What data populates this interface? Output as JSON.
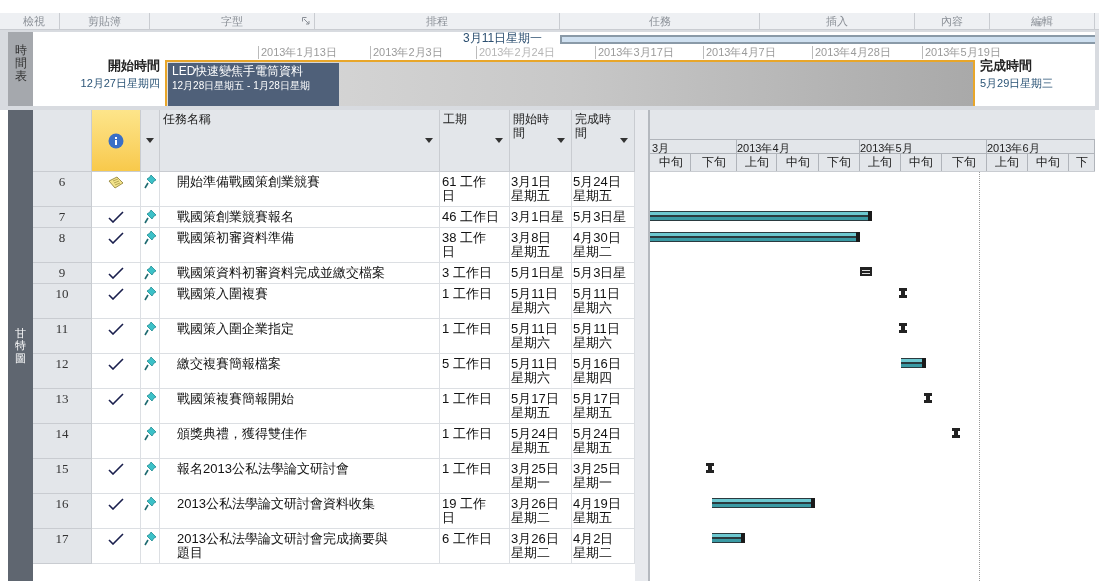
{
  "ribbon_groups": [
    {
      "label": "檢視"
    },
    {
      "label": "剪貼簿"
    },
    {
      "label": "字型",
      "launcher": true
    },
    {
      "label": "排程"
    },
    {
      "label": "任務"
    },
    {
      "label": "插入"
    },
    {
      "label": "內容"
    },
    {
      "label": "編輯"
    }
  ],
  "timeline": {
    "side_label": "時間表",
    "start_label": "開始時間",
    "start_date": "12月27日星期四",
    "today_label": "3月11日星期一",
    "ticks": [
      "2013年1月13日",
      "2013年2月3日",
      "2013年2月24日",
      "2013年3月17日",
      "2013年4月7日",
      "2013年4月28日",
      "2013年5月19日"
    ],
    "callout": {
      "title": "LED快速變焦手電筒資料",
      "dates": "12月28日星期五 - 1月28日星期"
    },
    "finish_label": "完成時間",
    "finish_date": "5月29日星期三"
  },
  "view_label": "甘特圖",
  "columns": [
    {
      "kind": "indicator",
      "selected": true
    },
    {
      "kind": "mode",
      "selected": false
    },
    {
      "kind": "text",
      "label": [
        "任務名稱"
      ],
      "selected": false
    },
    {
      "kind": "text",
      "label": [
        "工期"
      ],
      "selected": false
    },
    {
      "kind": "text",
      "label": [
        "開始時",
        "間"
      ],
      "selected": false
    },
    {
      "kind": "text",
      "label": [
        "完成時",
        "間"
      ],
      "selected": false
    }
  ],
  "timescale": {
    "months": [
      "3月",
      "2013年4月",
      "2013年5月",
      "2013年6月"
    ],
    "thirds": [
      "中旬",
      "下旬",
      "上旬",
      "中旬",
      "下旬",
      "上旬",
      "中旬",
      "下旬",
      "上旬",
      "中旬",
      "下"
    ]
  },
  "rows": [
    {
      "id": "6",
      "note": true,
      "complete": false,
      "name": [
        "開始準備戰國策創業競賽"
      ],
      "duration": [
        "61 工作",
        "日"
      ],
      "start": [
        "3月1日",
        "星期五"
      ],
      "finish": [
        "5月24日",
        "星期五"
      ]
    },
    {
      "id": "7",
      "note": false,
      "complete": true,
      "name": [
        "戰國策創業競賽報名"
      ],
      "duration": [
        "46 工作日"
      ],
      "start": [
        "3月1日星"
      ],
      "finish": [
        "5月3日星"
      ]
    },
    {
      "id": "8",
      "note": false,
      "complete": true,
      "name": [
        "戰國策初審資料準備"
      ],
      "duration": [
        "38 工作",
        "日"
      ],
      "start": [
        "3月8日",
        "星期五"
      ],
      "finish": [
        "4月30日",
        "星期二"
      ]
    },
    {
      "id": "9",
      "note": false,
      "complete": true,
      "name": [
        "戰國策資料初審資料完成並繳交檔案"
      ],
      "duration": [
        "3 工作日"
      ],
      "start": [
        "5月1日星"
      ],
      "finish": [
        "5月3日星"
      ]
    },
    {
      "id": "10",
      "note": false,
      "complete": true,
      "name": [
        "戰國策入圍複賽"
      ],
      "duration": [
        "1 工作日"
      ],
      "start": [
        "5月11日",
        "星期六"
      ],
      "finish": [
        "5月11日",
        "星期六"
      ]
    },
    {
      "id": "11",
      "note": false,
      "complete": true,
      "name": [
        "戰國策入圍企業指定"
      ],
      "duration": [
        "1 工作日"
      ],
      "start": [
        "5月11日",
        "星期六"
      ],
      "finish": [
        "5月11日",
        "星期六"
      ]
    },
    {
      "id": "12",
      "note": false,
      "complete": true,
      "name": [
        "繳交複賽簡報檔案"
      ],
      "duration": [
        "5 工作日"
      ],
      "start": [
        "5月11日",
        "星期六"
      ],
      "finish": [
        "5月16日",
        "星期四"
      ]
    },
    {
      "id": "13",
      "note": false,
      "complete": true,
      "name": [
        "戰國策複賽簡報開始"
      ],
      "duration": [
        "1 工作日"
      ],
      "start": [
        "5月17日",
        "星期五"
      ],
      "finish": [
        "5月17日",
        "星期五"
      ]
    },
    {
      "id": "14",
      "note": false,
      "complete": false,
      "name": [
        "頒獎典禮，獲得雙佳作"
      ],
      "duration": [
        "1 工作日"
      ],
      "start": [
        "5月24日",
        "星期五"
      ],
      "finish": [
        "5月24日",
        "星期五"
      ]
    },
    {
      "id": "15",
      "note": false,
      "complete": true,
      "name": [
        "報名2013公私法學論文研討會"
      ],
      "duration": [
        "1 工作日"
      ],
      "start": [
        "3月25日",
        "星期一"
      ],
      "finish": [
        "3月25日",
        "星期一"
      ]
    },
    {
      "id": "16",
      "note": false,
      "complete": true,
      "name": [
        "2013公私法學論文研討會資料收集"
      ],
      "duration": [
        "19 工作",
        "日"
      ],
      "start": [
        "3月26日",
        "星期二"
      ],
      "finish": [
        "4月19日",
        "星期五"
      ]
    },
    {
      "id": "17",
      "note": false,
      "complete": true,
      "name": [
        "2013公私法學論文研討會完成摘要與",
        "題目"
      ],
      "duration": [
        "6 工作日"
      ],
      "start": [
        "3月26日",
        "星期二"
      ],
      "finish": [
        "4月2日",
        "星期二"
      ]
    }
  ]
}
